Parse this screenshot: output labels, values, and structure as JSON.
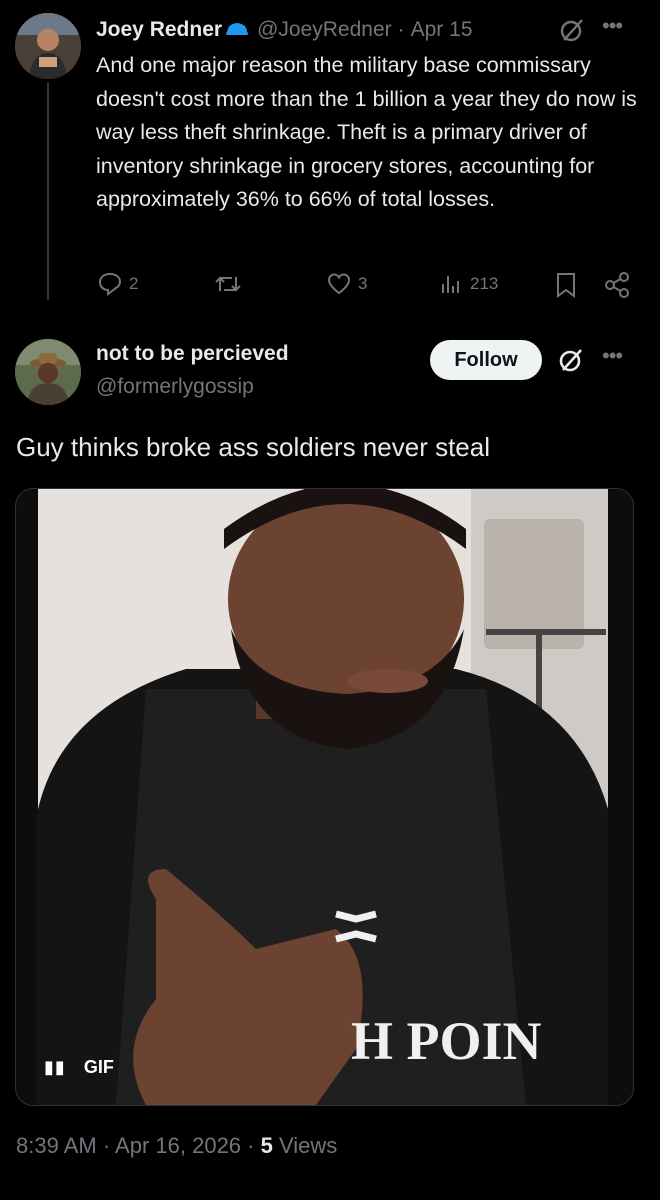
{
  "parent_tweet": {
    "display_name": "Joey Redner",
    "handle": "@JoeyRedner",
    "date": "Apr 15",
    "text": "And one major reason the military base commissary doesn't cost more than the 1 billion a year they do now is way less theft shrinkage. Theft is a primary driver of inventory shrinkage in grocery stores, accounting for approximately 36% to 66% of total losses.",
    "replies": "2",
    "likes": "3",
    "views": "213",
    "icons": [
      "verified-badge-icon",
      "grok-icon",
      "more-icon",
      "reply-icon",
      "retweet-icon",
      "like-icon",
      "views-icon",
      "bookmark-icon",
      "share-icon"
    ]
  },
  "main_tweet": {
    "display_name": "not to be percieved",
    "handle": "@formerlygossip",
    "follow_label": "Follow",
    "text": "Guy thinks broke ass soldiers never steal",
    "media_badge": "GIF",
    "media_jersey_text": "H POIN",
    "timestamp": "8:39 AM · Apr 16, 2026 · ",
    "views_count": "5",
    "views_label": " Views",
    "icons": [
      "grok-icon",
      "more-icon",
      "pause-icon",
      "under-armour-logo-icon"
    ]
  },
  "colors": {
    "background": "#000000",
    "text": "#e7e9ea",
    "muted": "#71767b",
    "verified_blue": "#1d9bf0",
    "follow_bg": "#eff3f4"
  }
}
